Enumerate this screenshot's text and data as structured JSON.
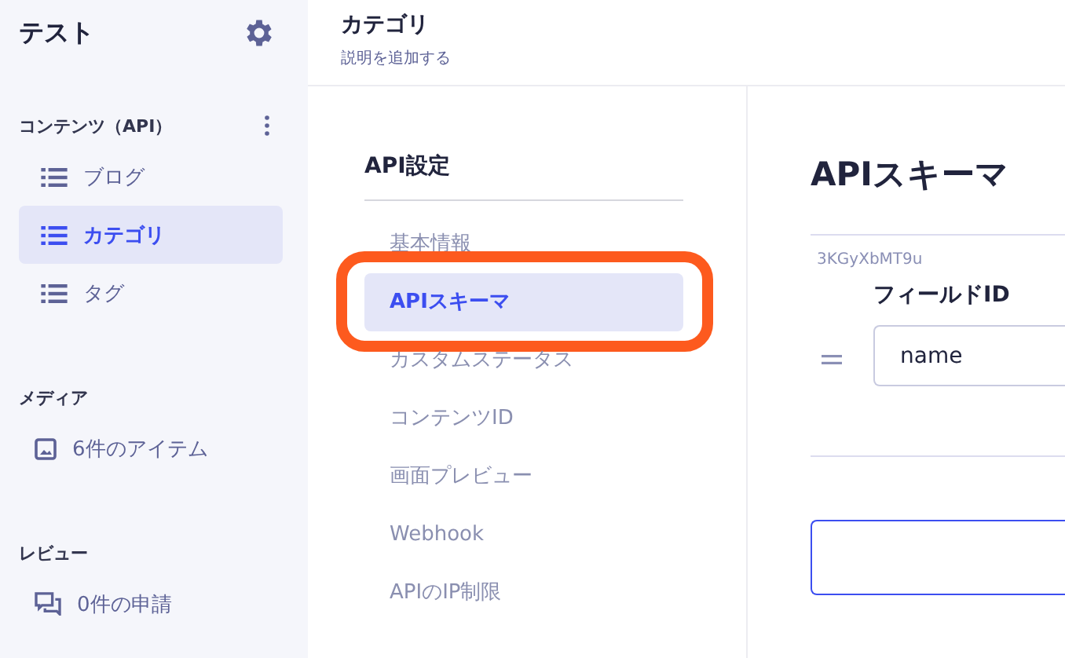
{
  "sidebar": {
    "title": "テスト",
    "sections": [
      {
        "title": "コンテンツ（API）",
        "has_menu": true,
        "items": [
          {
            "label": "ブログ",
            "kind": "list",
            "selected": false
          },
          {
            "label": "カテゴリ",
            "kind": "list",
            "selected": true
          },
          {
            "label": "タグ",
            "kind": "list",
            "selected": false
          }
        ]
      },
      {
        "title": "メディア",
        "has_menu": false,
        "items": [
          {
            "label": "6件のアイテム",
            "kind": "media",
            "selected": false
          }
        ]
      },
      {
        "title": "レビュー",
        "has_menu": false,
        "items": [
          {
            "label": "0件の申請",
            "kind": "review",
            "selected": false
          }
        ]
      }
    ]
  },
  "header": {
    "title": "カテゴリ",
    "subtitle": "説明を追加する"
  },
  "settings_nav": {
    "title": "API設定",
    "items": [
      {
        "label": "基本情報",
        "selected": false
      },
      {
        "label": "APIスキーマ",
        "selected": true
      },
      {
        "label": "カスタムステータス",
        "selected": false
      },
      {
        "label": "コンテンツID",
        "selected": false
      },
      {
        "label": "画面プレビュー",
        "selected": false
      },
      {
        "label": "Webhook",
        "selected": false
      },
      {
        "label": "APIのIP制限",
        "selected": false
      }
    ]
  },
  "schema": {
    "title": "APIスキーマ",
    "fields": [
      {
        "id": "3KGyXbMT9u",
        "label": "フィールドID",
        "value": "name"
      }
    ],
    "new_field": {
      "focused": true
    }
  }
}
